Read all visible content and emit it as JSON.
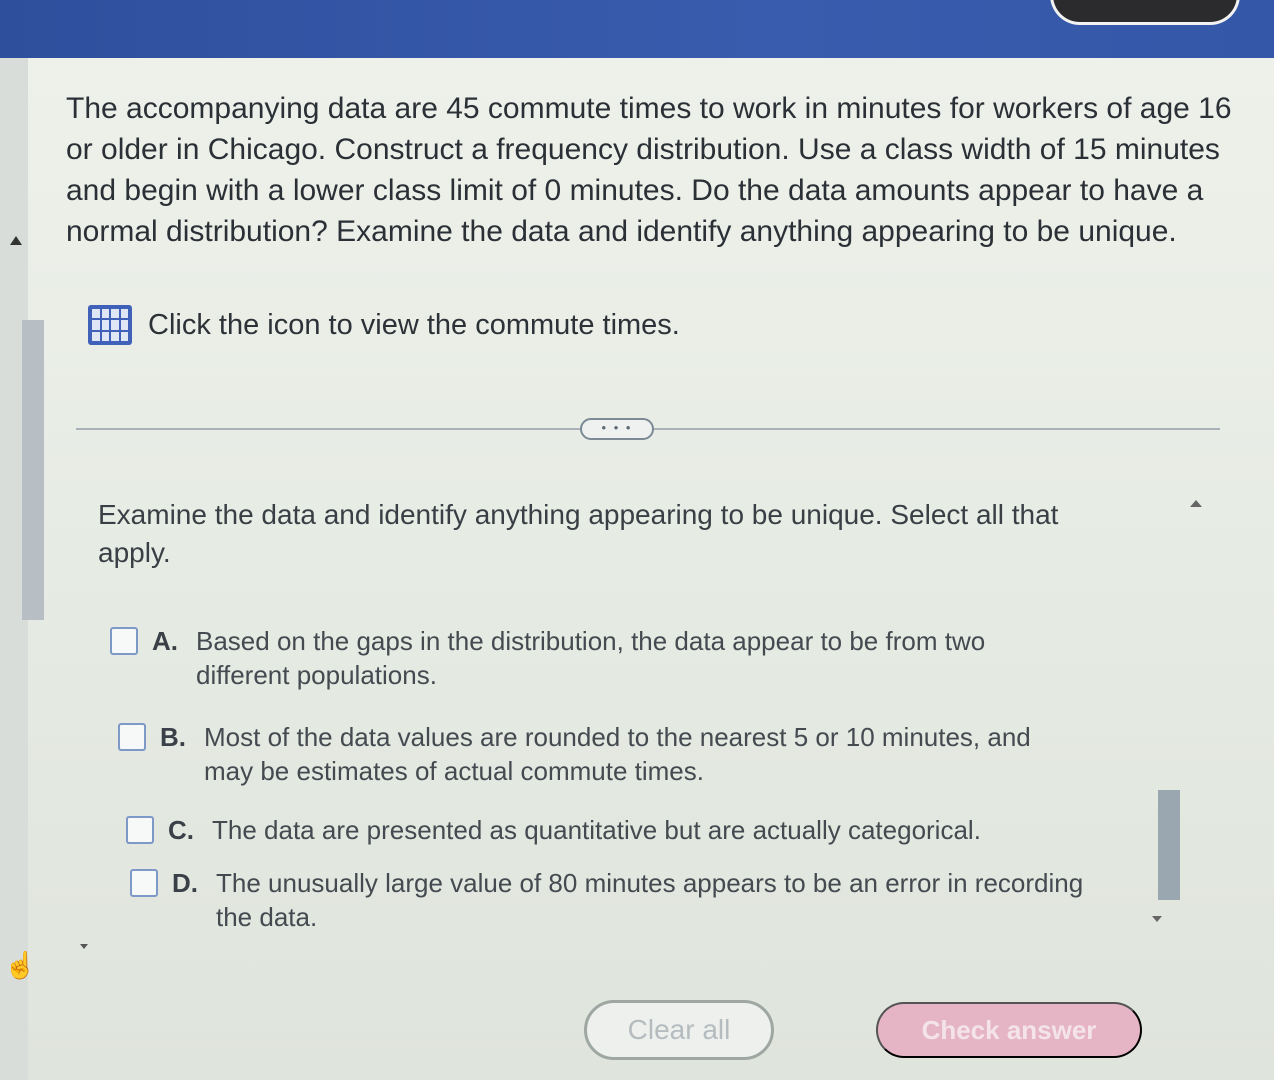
{
  "question": {
    "text": "The accompanying data are 45 commute times to work in minutes for workers of age 16 or older in Chicago. Construct a frequency distribution. Use a class width of 15 minutes and begin with a lower class limit of 0 minutes. Do the data amounts appear to have a normal distribution? Examine the data and identify anything appearing to be unique."
  },
  "data_link": {
    "label": "Click the icon to view the commute times.",
    "icon": "grid-data-icon"
  },
  "expand": {
    "label": "• • •"
  },
  "sub_question": {
    "text": "Examine the data and identify anything appearing to be unique. Select all that apply."
  },
  "options": [
    {
      "letter": "A.",
      "text": "Based on the gaps in the distribution, the data appear to be from two different populations.",
      "checked": false
    },
    {
      "letter": "B.",
      "text": "Most of the data values are rounded to the nearest 5 or 10 minutes, and may be estimates of actual commute times.",
      "checked": false
    },
    {
      "letter": "C.",
      "text": "The data are presented as quantitative but are actually categorical.",
      "checked": false
    },
    {
      "letter": "D.",
      "text": "The unusually large value of 80 minutes appears to be an error in recording the data.",
      "checked": false
    }
  ],
  "buttons": {
    "clear_all": "Clear all",
    "check_answer": "Check answer"
  },
  "colors": {
    "header": "#3457a8",
    "check_answer_bg": "#e5b5c6",
    "checkbox_border": "#7e98c7"
  }
}
